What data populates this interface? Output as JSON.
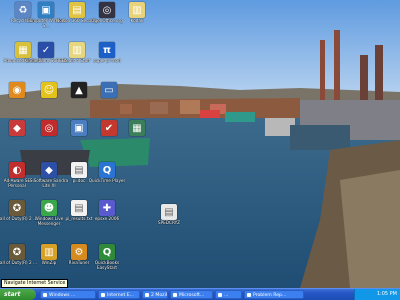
{
  "desktop": {
    "icons": [
      {
        "label": "Recycle Bin",
        "icon": "recycle-bin-icon",
        "color": "#5c87c4",
        "glyph": "♻"
      },
      {
        "label": "Computer Window S...",
        "icon": "computer-window-icon",
        "color": "#2f7fc2",
        "glyph": "▣"
      },
      {
        "label": "Norton 360 Security",
        "icon": "norton-icon",
        "color": "#e0c341",
        "glyph": "▤"
      },
      {
        "label": "OpenOffice.org",
        "icon": "openoffice-icon",
        "color": "#333344",
        "glyph": "◎"
      },
      {
        "label": "Kodak",
        "icon": "kodak-folder-icon",
        "color": "#e8d37a",
        "glyph": "▥"
      },
      {
        "label": "Advanced Uninstal",
        "icon": "uninstaller-icon",
        "color": "#d8c13a",
        "glyph": "▦"
      },
      {
        "label": "Kindle Ware SCREEN",
        "icon": "kindle-icon",
        "color": "#2a4ea8",
        "glyph": "✓"
      },
      {
        "label": "Leafs 4 Stuff",
        "icon": "folder-icon",
        "color": "#e6d77e",
        "glyph": "▥"
      },
      {
        "label": "super pi mod",
        "icon": "super-pi-icon",
        "color": "#1b5fc7",
        "glyph": "π"
      },
      {
        "label": "",
        "icon": "pumpkin-app-icon",
        "color": "#e08a1e",
        "glyph": "◉"
      },
      {
        "label": "",
        "icon": "yellow-smiley-icon",
        "color": "#e3c21a",
        "glyph": "☺"
      },
      {
        "label": "",
        "icon": "graduation-cap-icon",
        "color": "#222222",
        "glyph": "▲"
      },
      {
        "label": "",
        "icon": "monitor-icon",
        "color": "#3b6fb5",
        "glyph": "▭"
      },
      {
        "label": "",
        "icon": "shortcut-icon",
        "color": "#c93a3a",
        "glyph": "◆"
      },
      {
        "label": "",
        "icon": "target-app-icon",
        "color": "#c22b2b",
        "glyph": "◎"
      },
      {
        "label": "",
        "icon": "app-shortcut-icon",
        "color": "#4a7ec0",
        "glyph": "▣"
      },
      {
        "label": "",
        "icon": "checkmark-app-icon",
        "color": "#c4392f",
        "glyph": "✔"
      },
      {
        "label": "",
        "icon": "photo-app-icon",
        "color": "#3b7f5a",
        "glyph": "▦"
      },
      {
        "label": "Ad-Aware SE Personal",
        "icon": "ad-aware-icon",
        "color": "#c22d2d",
        "glyph": "◐"
      },
      {
        "label": "SiSoftware Sandra Lite XI",
        "icon": "sandra-icon",
        "color": "#2d4fa5",
        "glyph": "◆"
      },
      {
        "label": "pi.doc",
        "icon": "document-icon",
        "color": "#f2f2f2",
        "glyph": "▤"
      },
      {
        "label": "QuickTime Player",
        "icon": "quicktime-icon",
        "color": "#2a74d6",
        "glyph": "Q"
      },
      {
        "label": "Call of Duty(R) 2 ...",
        "icon": "cod2-icon",
        "color": "#6b5a3a",
        "glyph": "✪"
      },
      {
        "label": "Windows Live Messenger",
        "icon": "messenger-icon",
        "color": "#3aa84a",
        "glyph": "☻"
      },
      {
        "label": "pi_results.txt",
        "icon": "text-file-icon",
        "color": "#f2f2f2",
        "glyph": "▤"
      },
      {
        "label": "epsxe 2006",
        "icon": "epsxe-icon",
        "color": "#5a5acf",
        "glyph": "✚"
      },
      {
        "label": "SPEDCRYZ",
        "icon": "pdf-icon",
        "color": "#e8e8e8",
        "glyph": "▤"
      },
      {
        "label": "Call of Duty(R) 2 ...",
        "icon": "cod2-multiplayer-icon",
        "color": "#6b5a3a",
        "glyph": "✪"
      },
      {
        "label": "WinZip",
        "icon": "winzip-icon",
        "color": "#d7a127",
        "glyph": "▥"
      },
      {
        "label": "RivaTuner",
        "icon": "rivatuner-icon",
        "color": "#d78b1e",
        "glyph": "⚙"
      },
      {
        "label": "QuickBooks EasyStart",
        "icon": "quickbooks-icon",
        "color": "#2f8a3a",
        "glyph": "Q"
      }
    ]
  },
  "tooltip": {
    "text": "Navigate Internet Service"
  },
  "taskbar": {
    "start_label": "start",
    "buttons": [
      {
        "label": "Windows ..."
      },
      {
        "label": "Internet E..."
      },
      {
        "label": "2 Mozilla..."
      },
      {
        "label": "Microsoft..."
      },
      {
        "label": "..."
      },
      {
        "label": "Problem Rep..."
      }
    ],
    "clock": "1:05 PM"
  }
}
